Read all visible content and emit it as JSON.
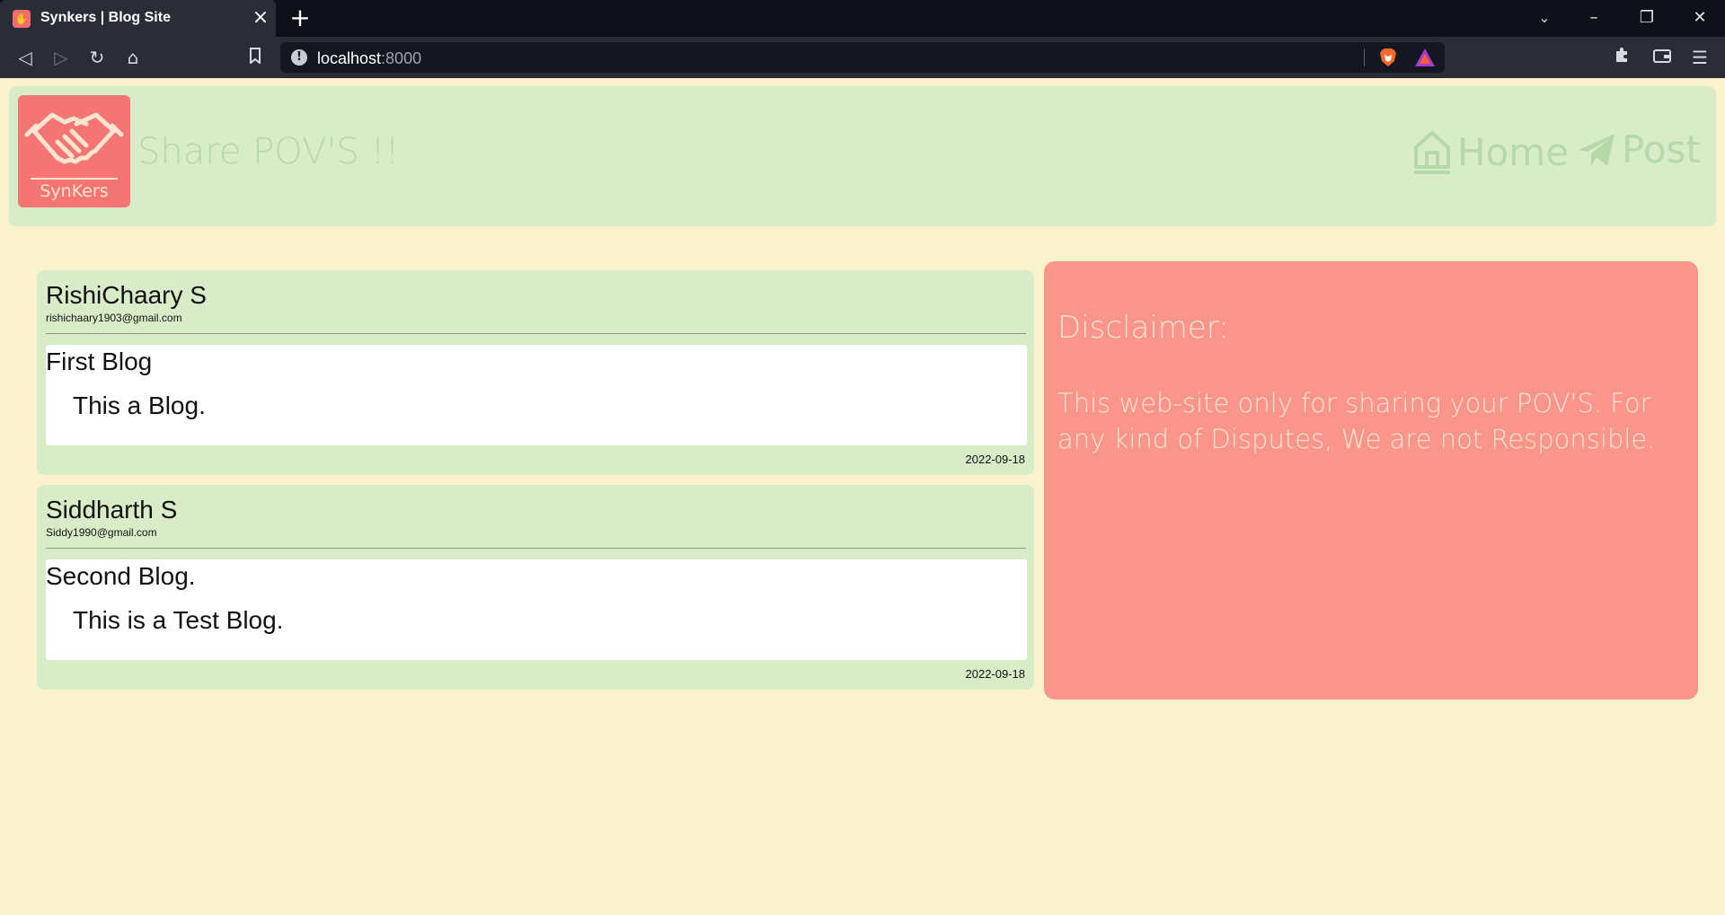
{
  "browser": {
    "tab": {
      "title": "Synkers | Blog Site"
    },
    "url": {
      "host": "localhost",
      "port": ":8000"
    }
  },
  "site": {
    "logo_text": "SynKers",
    "tagline": "Share POV'S !!",
    "nav": {
      "home": "Home",
      "post": "Post"
    },
    "colors": {
      "navbar": "#d8ecc7",
      "logo": "#f57575",
      "disclaimer": "#f9958a",
      "background": "#faf1cd"
    }
  },
  "posts": [
    {
      "author": "RishiChaary S",
      "email": "rishichaary1903@gmail.com",
      "title": "First Blog",
      "content": "This a Blog.",
      "date": "2022-09-18"
    },
    {
      "author": "Siddharth S",
      "email": "Siddy1990@gmail.com",
      "title": "Second Blog.",
      "content": "This is a Test Blog.",
      "date": "2022-09-18"
    }
  ],
  "disclaimer": {
    "title": "Disclaimer:",
    "text": "This web-site only for sharing your POV'S. For any kind of Disputes, We are not Responsible."
  }
}
